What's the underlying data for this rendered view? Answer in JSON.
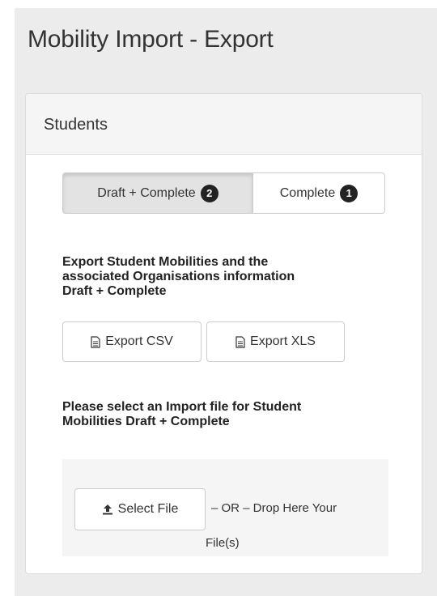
{
  "page": {
    "title": "Mobility Import - Export"
  },
  "panel": {
    "title": "Students"
  },
  "tabs": [
    {
      "label": "Draft + Complete",
      "badge": "2",
      "active": true
    },
    {
      "label": "Complete",
      "badge": "1",
      "active": false
    }
  ],
  "export": {
    "heading_line1": "Export Student Mobilities and the",
    "heading_line2": "associated Organisations information",
    "heading_line3": "Draft + Complete",
    "csv_label": "Export CSV",
    "xls_label": "Export XLS"
  },
  "import": {
    "heading_line1": "Please select an Import file for Student",
    "heading_line2": "Mobilities Draft + Complete",
    "select_label": "Select File",
    "or_text": "– OR – Drop Here Your",
    "files_text": "File(s)"
  },
  "icons": {
    "export": "file-text-icon",
    "upload": "upload-icon"
  },
  "colors": {
    "badge_bg": "#222222",
    "active_tab_bg": "#e3e3e3",
    "dropzone_bg": "#f5f5f5"
  }
}
